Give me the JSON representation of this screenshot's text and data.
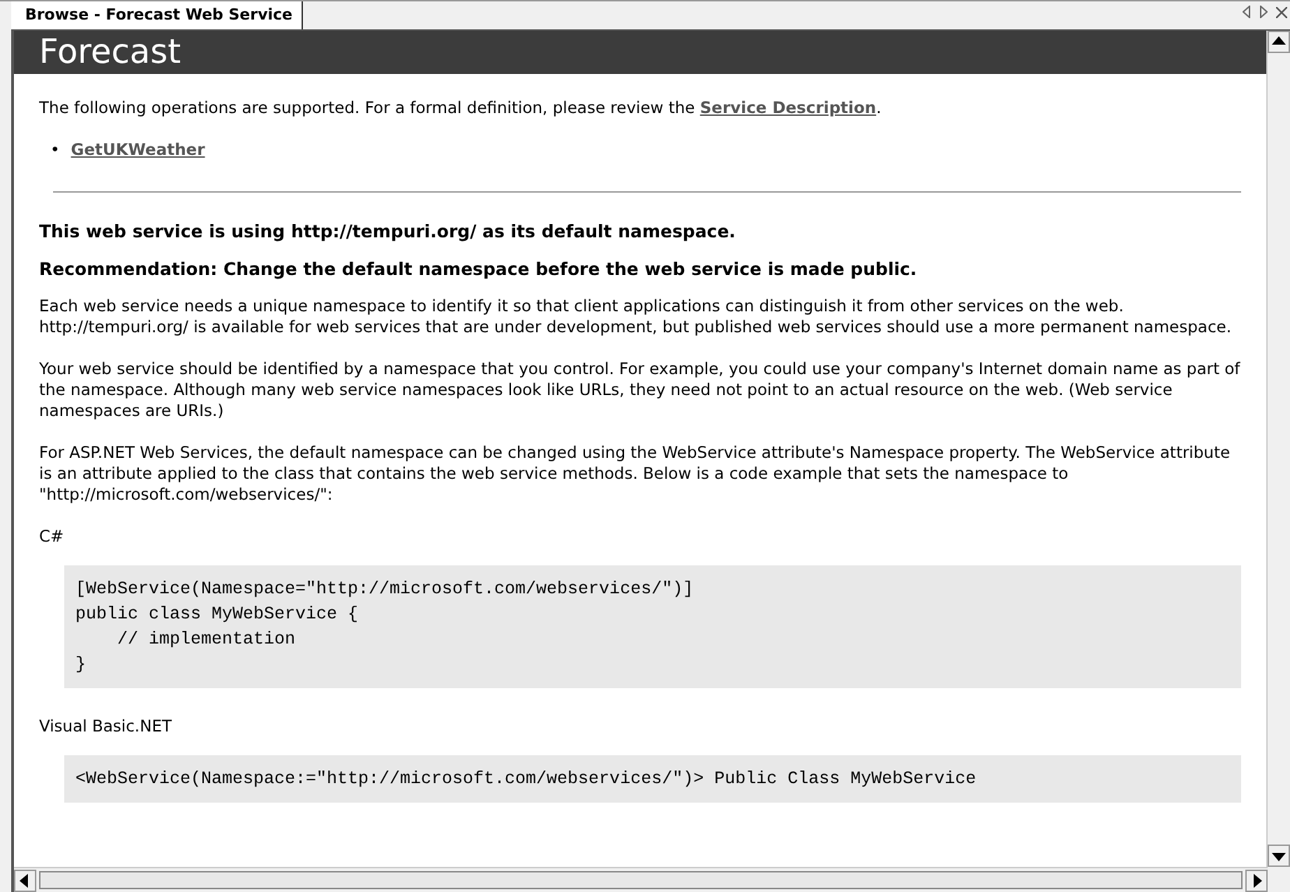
{
  "tabs": [
    {
      "label": "Browse - Forecast Web Service",
      "selected": true
    }
  ],
  "page": {
    "heading": "Forecast",
    "intro": {
      "before": "The following operations are supported. For a formal definition, please review the ",
      "link": "Service Description",
      "after": "."
    },
    "operations": [
      {
        "marker": "•",
        "name": "GetUKWeather"
      }
    ],
    "notices": [
      "This web service is using http://tempuri.org/ as its default namespace.",
      "Recommendation: Change the default namespace before the web service is made public."
    ],
    "paragraphs": [
      "Each web service needs a unique namespace to identify it so that client applications can distinguish it from other services on the web. http://tempuri.org/ is available for web services that are under development, but published web services should use a more permanent namespace.",
      "Your web service should be identified by a namespace that you control. For example, you could use your company's Internet domain name as part of the namespace. Although many web service namespaces look like URLs, they need not point to an actual resource on the web. (Web service namespaces are URIs.)",
      "For ASP.NET Web Services, the default namespace can be changed using the WebService attribute's Namespace property. The WebService attribute is an attribute applied to the class that contains the web service methods. Below is a code example that sets the namespace to \"http://microsoft.com/webservices/\":"
    ],
    "code_samples": [
      {
        "language": "C#",
        "lines": [
          "[WebService(Namespace=\"http://microsoft.com/webservices/\")]",
          "public class MyWebService {",
          "    // implementation",
          "}"
        ]
      },
      {
        "language": "Visual Basic.NET",
        "lines": [
          "<WebService(Namespace:=\"http://microsoft.com/webservices/\")> Public Class MyWebService"
        ]
      }
    ]
  }
}
